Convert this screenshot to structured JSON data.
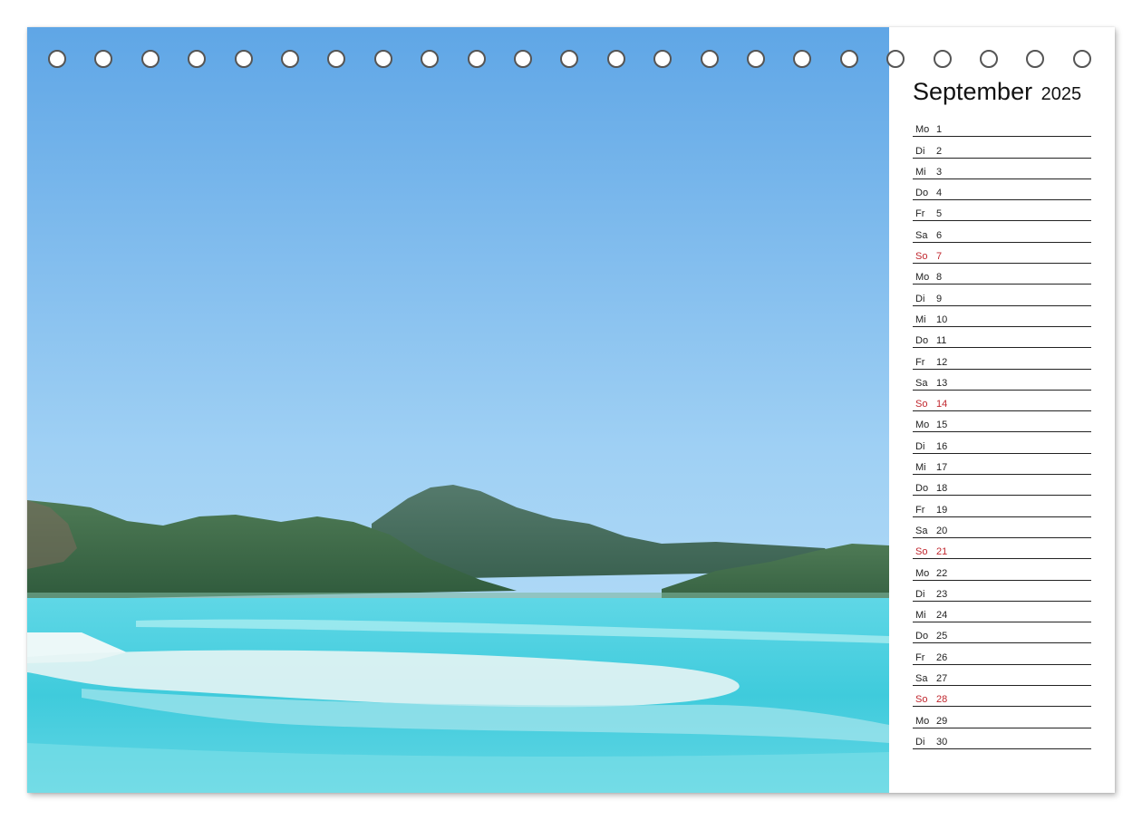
{
  "calendar": {
    "month": "September",
    "year": "2025",
    "sunday_color": "#c0262d",
    "days": [
      {
        "weekday": "Mo",
        "day": "1"
      },
      {
        "weekday": "Di",
        "day": "2"
      },
      {
        "weekday": "Mi",
        "day": "3"
      },
      {
        "weekday": "Do",
        "day": "4"
      },
      {
        "weekday": "Fr",
        "day": "5"
      },
      {
        "weekday": "Sa",
        "day": "6"
      },
      {
        "weekday": "So",
        "day": "7",
        "sunday": true
      },
      {
        "weekday": "Mo",
        "day": "8"
      },
      {
        "weekday": "Di",
        "day": "9"
      },
      {
        "weekday": "Mi",
        "day": "10"
      },
      {
        "weekday": "Do",
        "day": "11"
      },
      {
        "weekday": "Fr",
        "day": "12"
      },
      {
        "weekday": "Sa",
        "day": "13"
      },
      {
        "weekday": "So",
        "day": "14",
        "sunday": true
      },
      {
        "weekday": "Mo",
        "day": "15"
      },
      {
        "weekday": "Di",
        "day": "16"
      },
      {
        "weekday": "Mi",
        "day": "17"
      },
      {
        "weekday": "Do",
        "day": "18"
      },
      {
        "weekday": "Fr",
        "day": "19"
      },
      {
        "weekday": "Sa",
        "day": "20"
      },
      {
        "weekday": "So",
        "day": "21",
        "sunday": true
      },
      {
        "weekday": "Mo",
        "day": "22"
      },
      {
        "weekday": "Di",
        "day": "23"
      },
      {
        "weekday": "Mi",
        "day": "24"
      },
      {
        "weekday": "Do",
        "day": "25"
      },
      {
        "weekday": "Fr",
        "day": "26"
      },
      {
        "weekday": "Sa",
        "day": "27"
      },
      {
        "weekday": "So",
        "day": "28",
        "sunday": true
      },
      {
        "weekday": "Mo",
        "day": "29"
      },
      {
        "weekday": "Di",
        "day": "30"
      }
    ]
  },
  "photo": {
    "subject": "tropical-bay-landscape",
    "colors": {
      "sky_top": "#5fa6e6",
      "sky_bottom": "#b7def7",
      "hills": "#3f6a4a",
      "water": "#4fd0e0",
      "sand": "#eef6f6"
    }
  },
  "binding": {
    "ring_count": 23
  }
}
